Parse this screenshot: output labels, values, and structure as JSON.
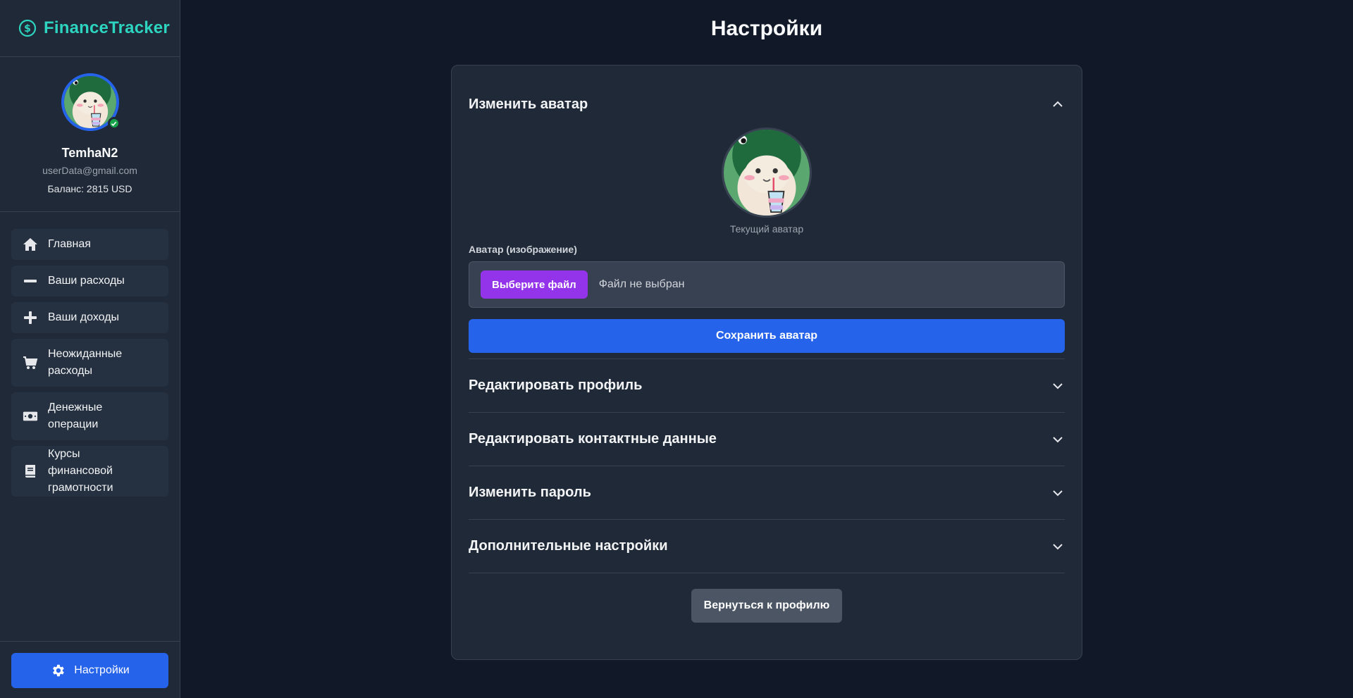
{
  "brand": {
    "name": "FinanceTracker",
    "icon": "dollar-circle-icon",
    "color": "#2dd4bf"
  },
  "user": {
    "username": "TemhaN2",
    "email": "userData@gmail.com",
    "balance_text": "Баланс: 2815 USD",
    "status": "online"
  },
  "nav": {
    "items": [
      {
        "label": "Главная",
        "icon": "home-icon"
      },
      {
        "label": "Ваши расходы",
        "icon": "minus-icon"
      },
      {
        "label": "Ваши доходы",
        "icon": "plus-icon"
      },
      {
        "label": "Неожиданные расходы",
        "icon": "cart-icon"
      },
      {
        "label": "Денежные операции",
        "icon": "money-bill-icon"
      },
      {
        "label": "Курсы финансовой грамотности",
        "icon": "book-icon"
      }
    ],
    "settings_label": "Настройки"
  },
  "page": {
    "title": "Настройки"
  },
  "avatar_section": {
    "title": "Изменить аватар",
    "expanded": true,
    "current_caption": "Текущий аватар",
    "field_label": "Аватар (изображение)",
    "file_button": "Выберите файл",
    "file_status": "Файл не выбран",
    "save_button": "Сохранить аватар"
  },
  "sections": [
    {
      "title": "Редактировать профиль",
      "expanded": false
    },
    {
      "title": "Редактировать контактные данные",
      "expanded": false
    },
    {
      "title": "Изменить пароль",
      "expanded": false
    },
    {
      "title": "Дополнительные настройки",
      "expanded": false
    }
  ],
  "back_button": "Вернуться к профилю",
  "colors": {
    "accent": "#2563eb",
    "file_button": "#9333ea",
    "background": "#111827",
    "panel": "#1f2937"
  }
}
